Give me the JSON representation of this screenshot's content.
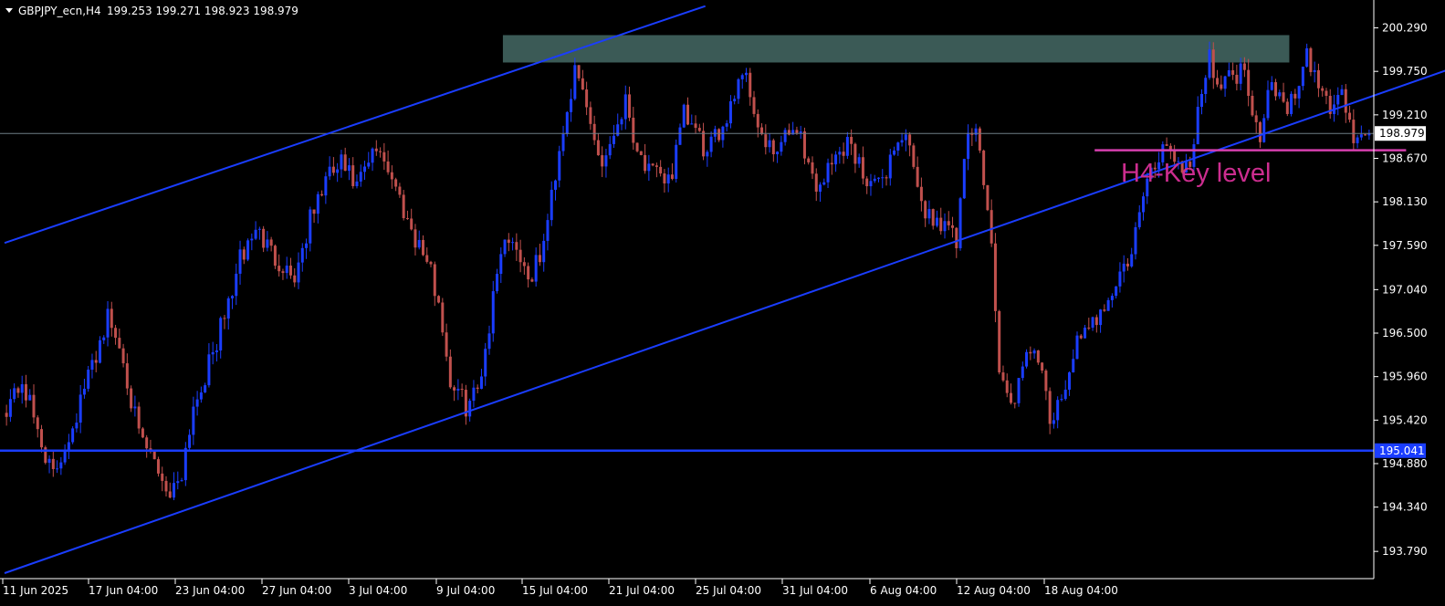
{
  "header": {
    "symbol_tf": "GBPJPY_ecn,H4",
    "ohlc": "199.253 199.271 198.923 198.979"
  },
  "colors": {
    "background": "#000000",
    "bull_candle": "#1a3dff",
    "bear_candle": "#c0504d",
    "channel": "#1a3dff",
    "support": "#1a3dff",
    "resistance_zone": "#3b5a56",
    "key_level": "#d63fae",
    "key_level_text": "#cc2d8f",
    "axis": "#ffffff",
    "current_price_line": "#6e7d86"
  },
  "chart_data": {
    "type": "candlestick",
    "symbol": "GBPJPY_ecn",
    "timeframe": "H4",
    "ylim": [
      193.52,
      200.5
    ],
    "y_ticks": [
      "200.290",
      "199.750",
      "199.210",
      "198.670",
      "198.130",
      "197.590",
      "197.040",
      "196.500",
      "195.960",
      "195.420",
      "194.880",
      "194.340",
      "193.790"
    ],
    "x_ticks": [
      "11 Jun 2025",
      "17 Jun 04:00",
      "23 Jun 04:00",
      "27 Jun 04:00",
      "3 Jul 04:00",
      "9 Jul 04:00",
      "15 Jul 04:00",
      "21 Jul 04:00",
      "25 Jul 04:00",
      "31 Jul 04:00",
      "6 Aug 04:00",
      "12 Aug 04:00",
      "18 Aug 04:00"
    ],
    "current_price": "198.979",
    "support_label": "195.041",
    "key_level_label": "H4-Key level",
    "path_anchors": [
      [
        0,
        195.6
      ],
      [
        4,
        195.9
      ],
      [
        8,
        195.3
      ],
      [
        12,
        194.7
      ],
      [
        15,
        195.1
      ],
      [
        18,
        195.5
      ],
      [
        22,
        196.1
      ],
      [
        26,
        196.7
      ],
      [
        30,
        196.2
      ],
      [
        34,
        195.2
      ],
      [
        38,
        194.9
      ],
      [
        42,
        194.5
      ],
      [
        45,
        194.8
      ],
      [
        48,
        195.6
      ],
      [
        52,
        196.1
      ],
      [
        56,
        196.7
      ],
      [
        60,
        197.4
      ],
      [
        64,
        197.8
      ],
      [
        68,
        197.5
      ],
      [
        72,
        197.3
      ],
      [
        74,
        197.2
      ],
      [
        78,
        197.9
      ],
      [
        82,
        198.4
      ],
      [
        86,
        198.6
      ],
      [
        90,
        198.3
      ],
      [
        94,
        198.7
      ],
      [
        96,
        198.8
      ],
      [
        100,
        198.3
      ],
      [
        104,
        197.8
      ],
      [
        108,
        197.4
      ],
      [
        111,
        196.9
      ],
      [
        114,
        195.9
      ],
      [
        118,
        195.6
      ],
      [
        121,
        195.8
      ],
      [
        124,
        196.6
      ],
      [
        127,
        197.6
      ],
      [
        130,
        197.7
      ],
      [
        133,
        197.3
      ],
      [
        135,
        197.2
      ],
      [
        138,
        197.6
      ],
      [
        140,
        198.2
      ],
      [
        142,
        198.8
      ],
      [
        144,
        199.3
      ],
      [
        146,
        199.7
      ],
      [
        148,
        199.5
      ],
      [
        150,
        199.1
      ],
      [
        153,
        198.6
      ],
      [
        156,
        199.0
      ],
      [
        159,
        199.4
      ],
      [
        162,
        198.8
      ],
      [
        165,
        198.5
      ],
      [
        168,
        198.4
      ],
      [
        171,
        198.5
      ],
      [
        174,
        199.2
      ],
      [
        177,
        199.0
      ],
      [
        180,
        198.7
      ],
      [
        184,
        199.1
      ],
      [
        187,
        199.5
      ],
      [
        189,
        199.8
      ],
      [
        191,
        199.5
      ],
      [
        194,
        198.9
      ],
      [
        197,
        198.7
      ],
      [
        200,
        198.9
      ],
      [
        203,
        199.1
      ],
      [
        206,
        198.6
      ],
      [
        208,
        198.3
      ],
      [
        212,
        198.6
      ],
      [
        216,
        198.9
      ],
      [
        220,
        198.5
      ],
      [
        224,
        198.3
      ],
      [
        228,
        198.8
      ],
      [
        231,
        199.0
      ],
      [
        234,
        198.2
      ],
      [
        238,
        197.9
      ],
      [
        241,
        197.9
      ],
      [
        244,
        197.6
      ],
      [
        247,
        199.0
      ],
      [
        250,
        198.9
      ],
      [
        253,
        197.6
      ],
      [
        255,
        196.0
      ],
      [
        258,
        195.6
      ],
      [
        261,
        196.0
      ],
      [
        264,
        196.4
      ],
      [
        268,
        195.4
      ],
      [
        271,
        195.6
      ],
      [
        274,
        196.3
      ],
      [
        278,
        196.5
      ],
      [
        282,
        196.9
      ],
      [
        285,
        197.1
      ],
      [
        289,
        197.5
      ],
      [
        292,
        198.2
      ],
      [
        295,
        198.6
      ],
      [
        298,
        198.9
      ],
      [
        301,
        198.6
      ],
      [
        304,
        198.6
      ],
      [
        306,
        199.3
      ],
      [
        309,
        199.9
      ],
      [
        312,
        199.6
      ],
      [
        315,
        199.7
      ],
      [
        318,
        199.8
      ],
      [
        320,
        199.3
      ],
      [
        322,
        199.0
      ],
      [
        325,
        199.7
      ],
      [
        328,
        199.3
      ],
      [
        331,
        199.4
      ],
      [
        334,
        199.9
      ],
      [
        337,
        199.6
      ],
      [
        340,
        199.3
      ],
      [
        343,
        199.5
      ],
      [
        346,
        198.9
      ],
      [
        349,
        199.0
      ],
      [
        350,
        198.98
      ]
    ],
    "resistance_zone": {
      "y_top": 200.2,
      "y_bottom": 199.86,
      "x_start_index": 128,
      "x_end_index": 330
    },
    "support_level": 195.041,
    "key_level": {
      "price": 198.77,
      "x_start_index": 280,
      "x_end_index": 360
    },
    "channel": {
      "upper": [
        [
          0,
          197.62
        ],
        [
          180,
          200.56
        ]
      ],
      "lower": [
        [
          0,
          193.52
        ],
        [
          420,
          200.6
        ]
      ]
    },
    "grid": false
  }
}
